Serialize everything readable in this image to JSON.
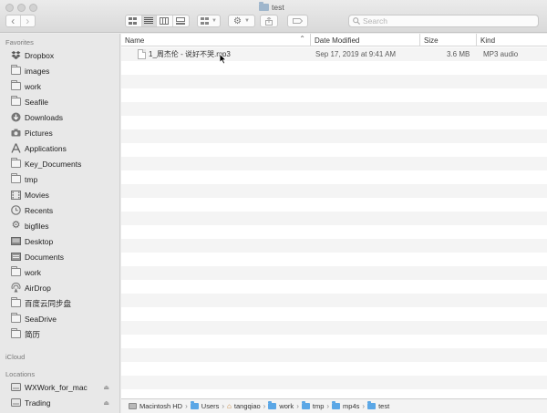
{
  "window": {
    "title": "test"
  },
  "toolbar": {
    "back_glyph": "‹",
    "forward_glyph": "›",
    "search_placeholder": "Search"
  },
  "sidebar": {
    "favorites_heading": "Favorites",
    "favorites": [
      {
        "label": "Dropbox",
        "icon": "dropbox-icon"
      },
      {
        "label": "images",
        "icon": "folder-icon"
      },
      {
        "label": "work",
        "icon": "folder-icon"
      },
      {
        "label": "Seafile",
        "icon": "folder-icon"
      },
      {
        "label": "Downloads",
        "icon": "downloads-icon"
      },
      {
        "label": "Pictures",
        "icon": "camera-icon"
      },
      {
        "label": "Applications",
        "icon": "applications-icon"
      },
      {
        "label": "Key_Documents",
        "icon": "folder-icon"
      },
      {
        "label": "tmp",
        "icon": "folder-icon"
      },
      {
        "label": "Movies",
        "icon": "film-icon"
      },
      {
        "label": "Recents",
        "icon": "clock-icon"
      },
      {
        "label": "bigfiles",
        "icon": "gear-icon"
      },
      {
        "label": "Desktop",
        "icon": "desktop-icon"
      },
      {
        "label": "Documents",
        "icon": "documents-icon"
      },
      {
        "label": "work",
        "icon": "folder-icon"
      },
      {
        "label": "AirDrop",
        "icon": "airdrop-icon"
      },
      {
        "label": "百度云同步盘",
        "icon": "folder-icon"
      },
      {
        "label": "SeaDrive",
        "icon": "folder-icon"
      },
      {
        "label": "简历",
        "icon": "folder-icon"
      }
    ],
    "icloud_heading": "iCloud",
    "locations_heading": "Locations",
    "locations": [
      {
        "label": "WXWork_for_mac",
        "icon": "disk-icon"
      },
      {
        "label": "Trading",
        "icon": "disk-icon"
      }
    ]
  },
  "list": {
    "columns": {
      "name": "Name",
      "date": "Date Modified",
      "size": "Size",
      "kind": "Kind"
    },
    "files": [
      {
        "name": "1_周杰伦 - 说好不哭.mp3",
        "date": "Sep 17, 2019 at 9:41 AM",
        "size": "3.6 MB",
        "kind": "MP3 audio"
      }
    ]
  },
  "pathbar": [
    {
      "label": "Macintosh HD",
      "icon": "disk"
    },
    {
      "label": "Users",
      "icon": "folder"
    },
    {
      "label": "tangqiao",
      "icon": "home"
    },
    {
      "label": "work",
      "icon": "folder"
    },
    {
      "label": "tmp",
      "icon": "folder"
    },
    {
      "label": "mp4s",
      "icon": "folder"
    },
    {
      "label": "test",
      "icon": "folder"
    }
  ]
}
